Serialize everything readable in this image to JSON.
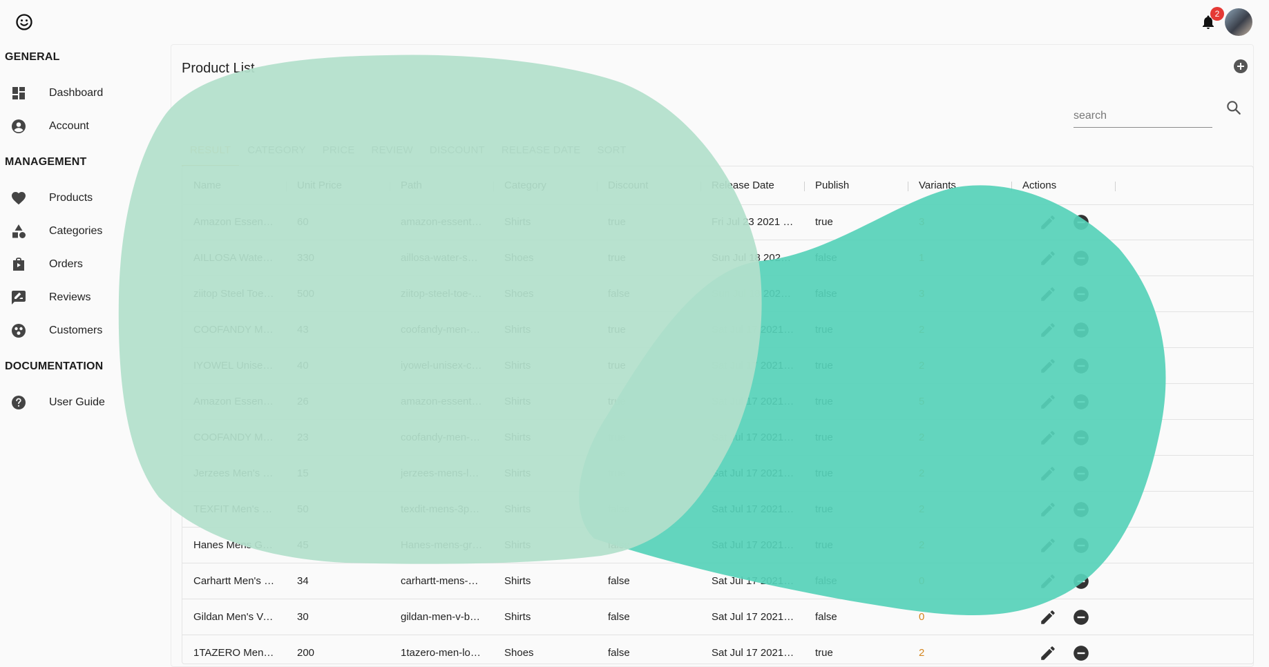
{
  "app": {
    "notifications_count": "2"
  },
  "sidebar": {
    "sections": [
      {
        "title": "GENERAL",
        "items": [
          {
            "label": "Dashboard",
            "icon": "dashboard-icon"
          },
          {
            "label": "Account",
            "icon": "account-circle-icon"
          }
        ]
      },
      {
        "title": "MANAGEMENT",
        "items": [
          {
            "label": "Products",
            "icon": "heart-icon"
          },
          {
            "label": "Categories",
            "icon": "category-shapes-icon"
          },
          {
            "label": "Orders",
            "icon": "shopping-bag-icon"
          },
          {
            "label": "Reviews",
            "icon": "rate-review-icon"
          },
          {
            "label": "Customers",
            "icon": "customers-icon"
          }
        ]
      },
      {
        "title": "DOCUMENTATION",
        "items": [
          {
            "label": "User Guide",
            "icon": "help-icon"
          }
        ]
      }
    ]
  },
  "main": {
    "title": "Product List",
    "search_placeholder": "search",
    "tabs": [
      "RESULT",
      "CATEGORY",
      "PRICE",
      "REVIEW",
      "DISCOUNT",
      "RELEASE DATE",
      "SORT"
    ],
    "active_tab": "RESULT",
    "columns": [
      "Name",
      "Unit Price",
      "Path",
      "Category",
      "Discount",
      "Release Date",
      "Publish",
      "Variants",
      "Actions"
    ],
    "rows": [
      [
        "Amazon Essenti…",
        "60",
        "amazon-essenti…",
        "Shirts",
        "true",
        "Fri Jul 23 2021 …",
        "true",
        "3"
      ],
      [
        "AILLOSA Water…",
        "330",
        "aillosa-water-sh…",
        "Shoes",
        "true",
        "Sun Jul 18 2021…",
        "false",
        "1"
      ],
      [
        "ziitop Steel Toe …",
        "500",
        "ziitop-steel-toe-…",
        "Shoes",
        "false",
        "Sun Jul 18 2021…",
        "false",
        "3"
      ],
      [
        "COOFANDY Me…",
        "43",
        "coofandy-men-c…",
        "Shirts",
        "true",
        "Sat Jul 17 2021 …",
        "true",
        "2"
      ],
      [
        "IYOWEL Unisex…",
        "40",
        "iyowel-unisex-c…",
        "Shirts",
        "true",
        "Sat Jul 17 2021 …",
        "true",
        "2"
      ],
      [
        "Amazon Essenti…",
        "26",
        "amazon-essenti…",
        "Shirts",
        "true",
        "Sat Jul 17 2021 …",
        "true",
        "5"
      ],
      [
        "COOFANDY Me…",
        "23",
        "coofandy-men-c…",
        "Shirts",
        "true",
        "Sat Jul 17 2021 …",
        "true",
        "2"
      ],
      [
        "Jerzees Men's L…",
        "15",
        "jerzees-mens-lo…",
        "Shirts",
        "true",
        "Sat Jul 17 2021 …",
        "true",
        "2"
      ],
      [
        "TEXFIT Men's 3…",
        "50",
        "texdit-mens-3pa…",
        "Shirts",
        "false",
        "Sat Jul 17 2021 …",
        "true",
        "2"
      ],
      [
        "Hanes Mens Gr…",
        "45",
        "Hanes-mens-gr…",
        "Shirts",
        "false",
        "Sat Jul 17 2021 …",
        "true",
        "2"
      ],
      [
        "Carhartt Men's …",
        "34",
        "carhartt-mens-k…",
        "Shirts",
        "false",
        "Sat Jul 17 2021 …",
        "false",
        "0"
      ],
      [
        "Gildan Men's V-…",
        "30",
        "gildan-men-v-be…",
        "Shirts",
        "false",
        "Sat Jul 17 2021 …",
        "false",
        "0"
      ],
      [
        "1TAZERO Men…",
        "200",
        "1tazero-men-lo…",
        "Shoes",
        "false",
        "Sat Jul 17 2021…",
        "true",
        "2"
      ]
    ]
  },
  "colors": {
    "accent": "#e0a35c",
    "variants": "#d4861f",
    "blob_light": "#b3e0cb",
    "blob_dark": "#56d1b8",
    "badge": "#e53935"
  }
}
